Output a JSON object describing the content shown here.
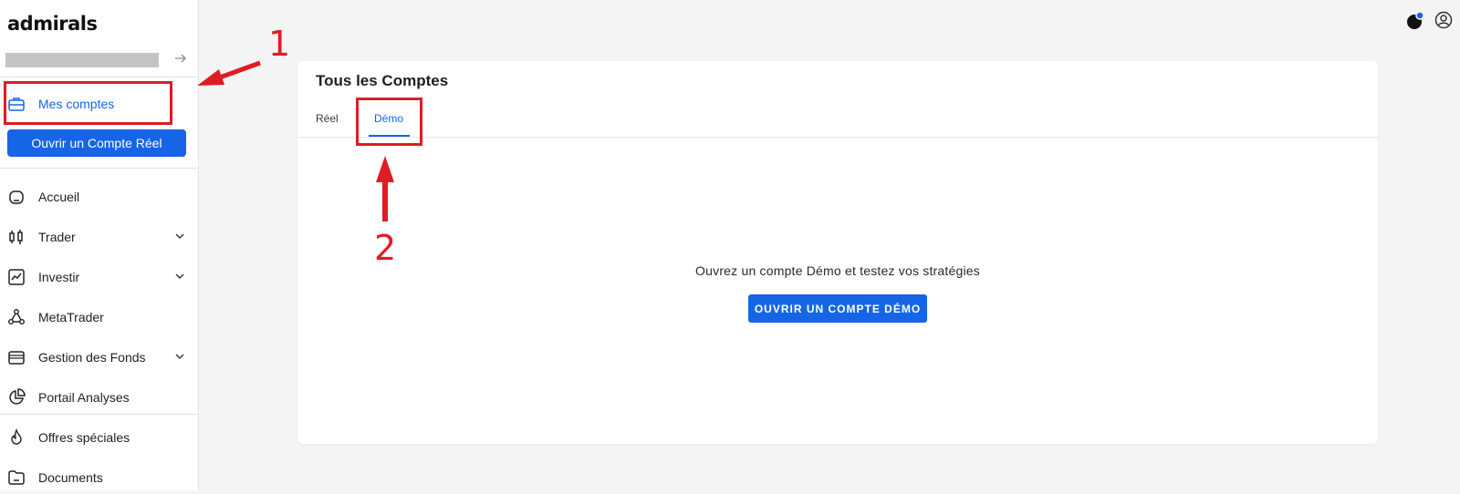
{
  "app": {
    "logo_text": "admirals"
  },
  "sidebar": {
    "my_accounts_label": "Mes comptes",
    "open_real_account_button": "Ouvrir un Compte Réel",
    "items": [
      {
        "label": "Accueil",
        "icon": "home-icon"
      },
      {
        "label": "Trader",
        "icon": "candlestick-icon",
        "expandable": true
      },
      {
        "label": "Investir",
        "icon": "chart-line-icon",
        "expandable": true
      },
      {
        "label": "MetaTrader",
        "icon": "network-icon"
      },
      {
        "label": "Gestion des Fonds",
        "icon": "wallet-icon",
        "expandable": true
      },
      {
        "label": "Portail Analyses",
        "icon": "pie-chart-icon"
      },
      {
        "label": "Offres spéciales",
        "icon": "flame-icon"
      },
      {
        "label": "Documents",
        "icon": "folder-icon"
      }
    ]
  },
  "main": {
    "card_title": "Tous les Comptes",
    "tabs": [
      {
        "label": "Réel",
        "active": false
      },
      {
        "label": "Démo",
        "active": true
      }
    ],
    "empty_message": "Ouvrez un compte Démo et testez vos stratégies",
    "open_demo_button": "OUVRIR UN COMPTE DÉMO"
  },
  "annotations": {
    "marker_1": "1",
    "marker_2": "2"
  },
  "colors": {
    "accent": "#1565e6",
    "annotation": "#e01b24",
    "background": "#f4f4f4"
  }
}
